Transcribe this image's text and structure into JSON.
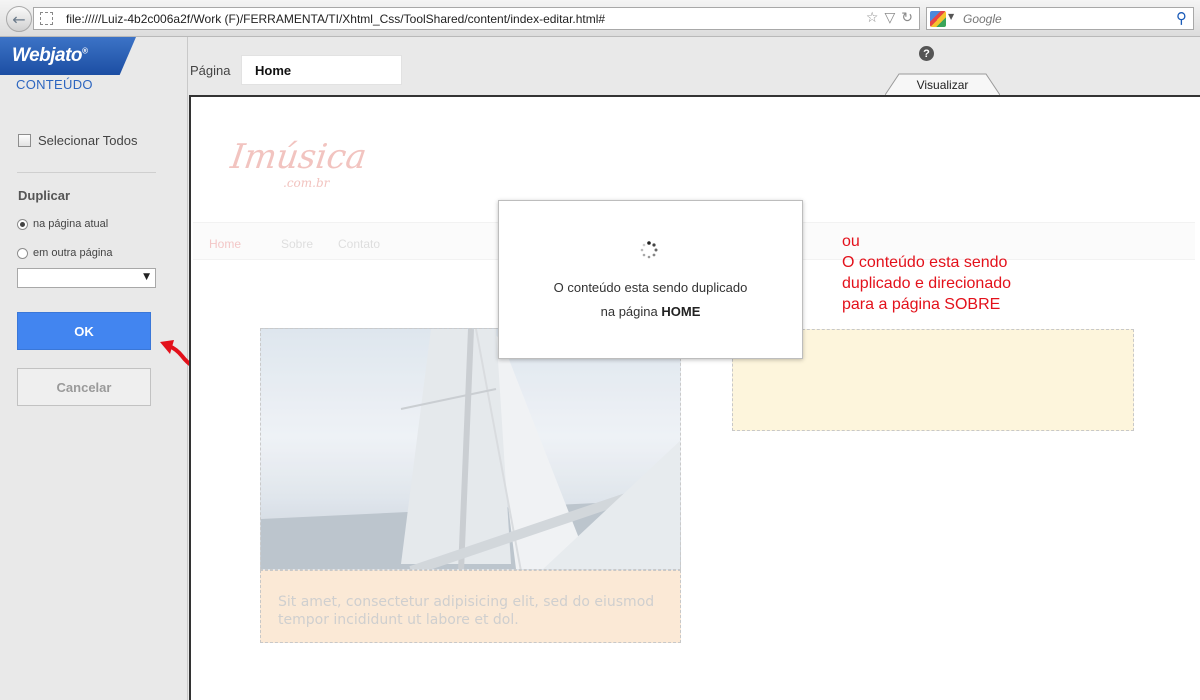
{
  "browser": {
    "url": "file://///Luiz-4b2c006a2f/Work  (F)/FERRAMENTA/TI/Xhtml_Css/ToolShared/content/index-editar.html#",
    "search_placeholder": "Google"
  },
  "sidebar": {
    "logo": "Webjato",
    "logo_mark": "®",
    "section_title": "CONTEÚDO",
    "select_all_label": "Selecionar Todos",
    "duplicate_title": "Duplicar",
    "radio_current": "na página atual",
    "radio_other": "em outra página",
    "select_value": "",
    "ok_label": "OK",
    "cancel_label": "Cancelar"
  },
  "header": {
    "page_label": "Página",
    "page_value": "Home",
    "help": "?",
    "preview_tab": "Visualizar"
  },
  "site": {
    "logo": "Imúsica",
    "logo_sub": ".com.br",
    "nav": [
      "Home",
      "Sobre",
      "Contato"
    ],
    "text_block": "Sit amet, consectetur adipisicing elit, sed do eiusmod tempor incididunt ut  labore et dol."
  },
  "modal": {
    "line1": "O conteúdo esta sendo duplicado",
    "line2_prefix": "na página",
    "line2_page": "HOME"
  },
  "annotation": {
    "line1": "ou",
    "line2": "O conteúdo esta sendo",
    "line3": "duplicado e direcionado",
    "line4": "para a página SOBRE",
    "color": "#e3111b"
  }
}
